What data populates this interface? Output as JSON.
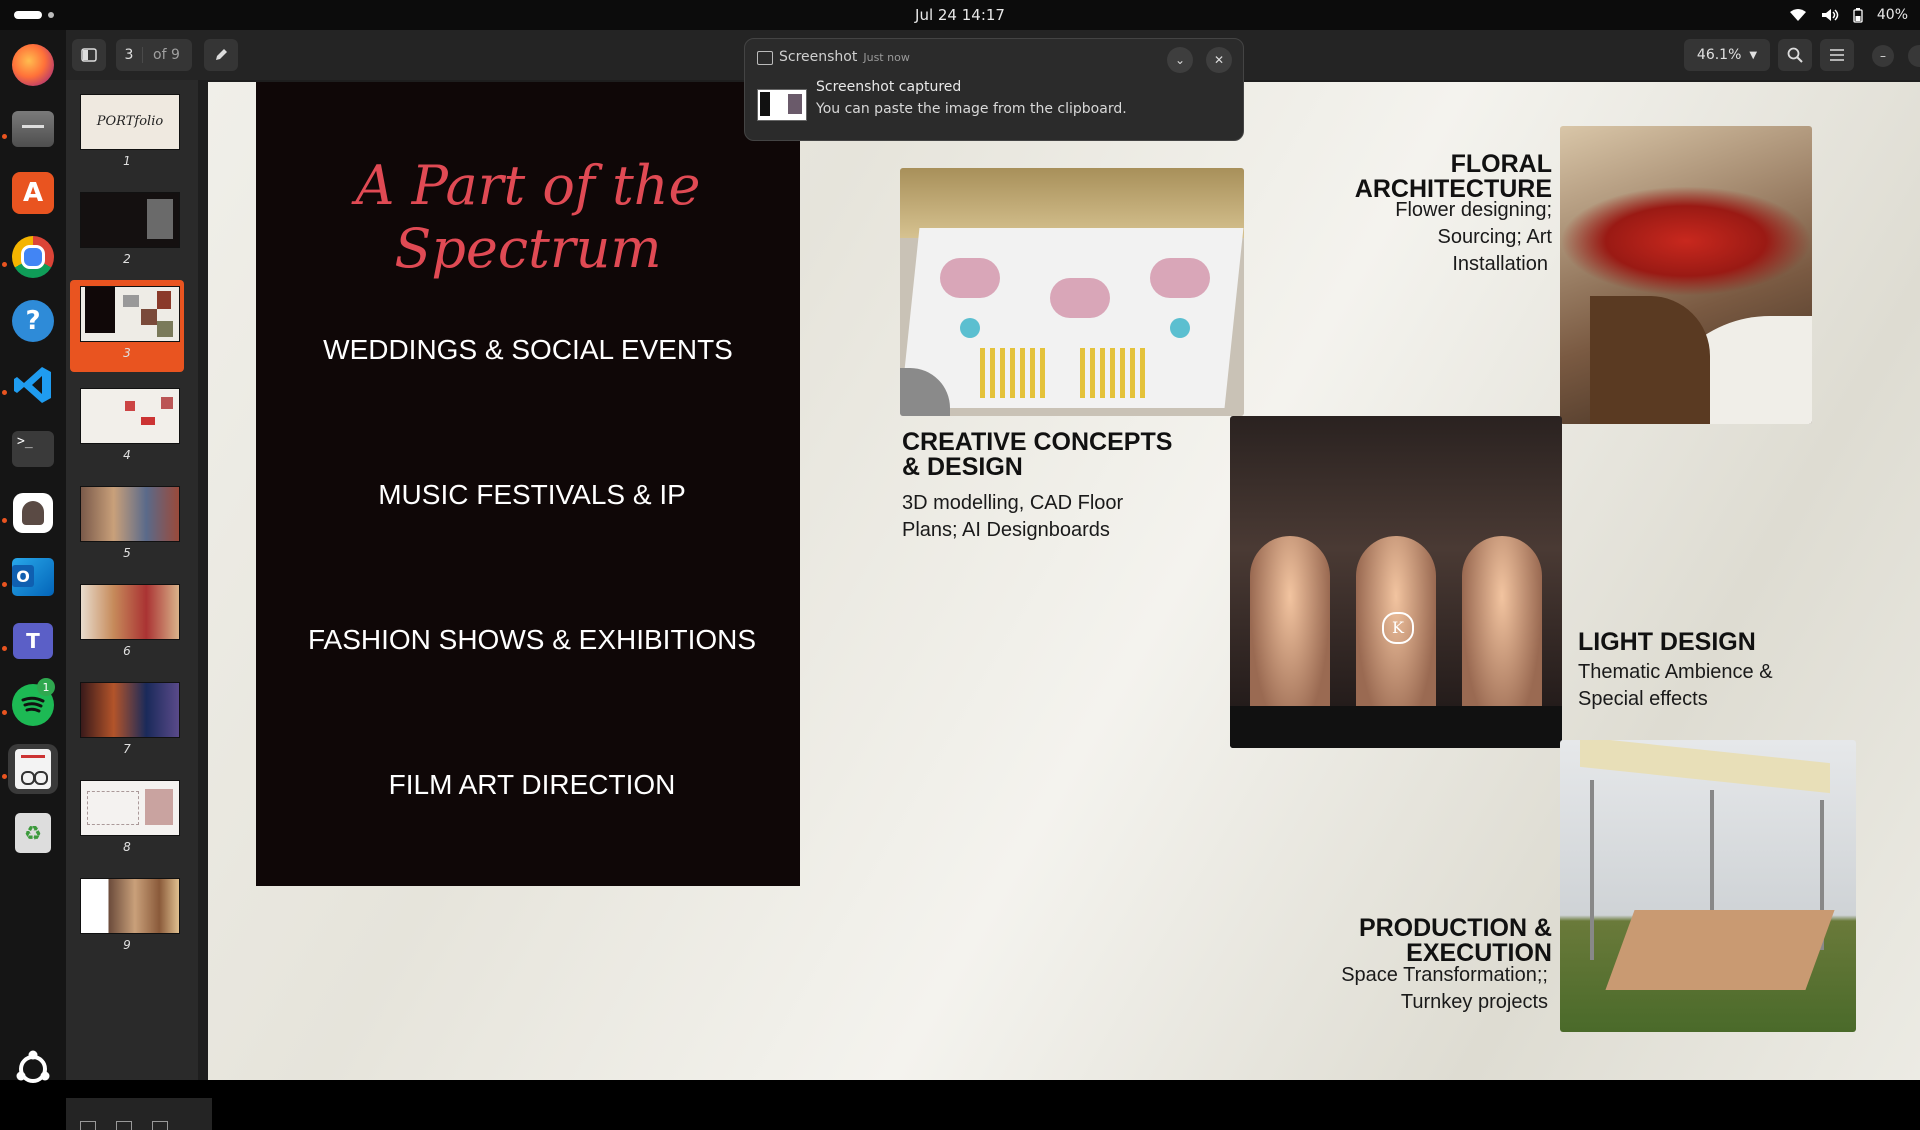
{
  "topbar": {
    "clock": "Jul 24  14:17",
    "battery": "40%"
  },
  "dock": {
    "apps": [
      "firefox",
      "files",
      "app-center",
      "chrome",
      "help",
      "vscode",
      "terminal",
      "image-viewer",
      "outlook",
      "teams",
      "spotify",
      "document-viewer",
      "trash"
    ],
    "spotify_badge": "1"
  },
  "viewer": {
    "current_page": "3",
    "page_total": "of 9",
    "zoom": "46.1%",
    "thumbnails": [
      "1",
      "2",
      "3",
      "4",
      "5",
      "6",
      "7",
      "8",
      "9"
    ],
    "selected_thumbnail": "3"
  },
  "notification": {
    "app": "Screenshot",
    "time": "Just now",
    "title": "Screenshot captured",
    "body": "You can paste the image from the clipboard."
  },
  "slide": {
    "title": "A Part of the Spectrum",
    "services": [
      "WEDDINGS & SOCIAL EVENTS",
      "MUSIC FESTIVALS & IP",
      "FASHION SHOWS & EXHIBITIONS",
      "FILM ART DIRECTION"
    ],
    "floral": {
      "heading1": "FLORAL",
      "heading2": "ARCHITECTURE",
      "desc1": "Flower designing;",
      "desc2": "Sourcing; Art",
      "desc3": "Installation"
    },
    "creative": {
      "heading1": "CREATIVE CONCEPTS",
      "heading2": "& DESIGN",
      "desc1": "3D modelling, CAD Floor",
      "desc2": "Plans; AI Designboards"
    },
    "light": {
      "heading": "LIGHT DESIGN",
      "desc1": "Thematic Ambience &",
      "desc2": "Special effects"
    },
    "production": {
      "heading1": "PRODUCTION &",
      "heading2": "EXECUTION",
      "desc1": "Space Transformation;;",
      "desc2": "Turnkey projects"
    },
    "stage_logo_letter": "K"
  }
}
